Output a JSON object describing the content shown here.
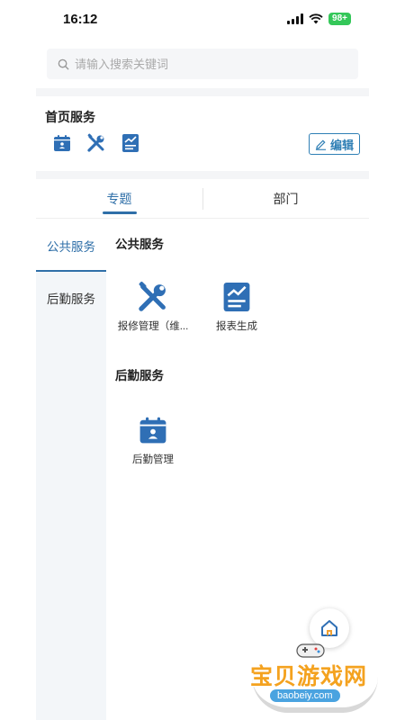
{
  "status_bar": {
    "time": "16:12",
    "battery": "98+"
  },
  "search": {
    "placeholder": "请输入搜索关键词"
  },
  "home_services": {
    "title": "首页服务",
    "quick_icons": [
      "calendar-icon",
      "tools-icon",
      "report-icon"
    ],
    "edit_label": "编辑"
  },
  "tabs": [
    {
      "label": "专题",
      "active": true
    },
    {
      "label": "部门",
      "active": false
    }
  ],
  "sidebar": {
    "items": [
      {
        "label": "公共服务",
        "active": true
      },
      {
        "label": "后勤服务",
        "active": false
      }
    ]
  },
  "groups": [
    {
      "title": "公共服务",
      "items": [
        {
          "label": "报修管理（维...",
          "icon": "tools-icon"
        },
        {
          "label": "报表生成",
          "icon": "report-icon"
        }
      ]
    },
    {
      "title": "后勤服务",
      "items": [
        {
          "label": "后勤管理",
          "icon": "calendar-icon"
        }
      ]
    }
  ],
  "watermark": {
    "text": "宝贝游戏网",
    "url": "baobeiy.com"
  },
  "colors": {
    "accent": "#2f6fa8",
    "icon_blue": "#2f6fb5",
    "sidebar_bg": "#f3f6f9"
  }
}
